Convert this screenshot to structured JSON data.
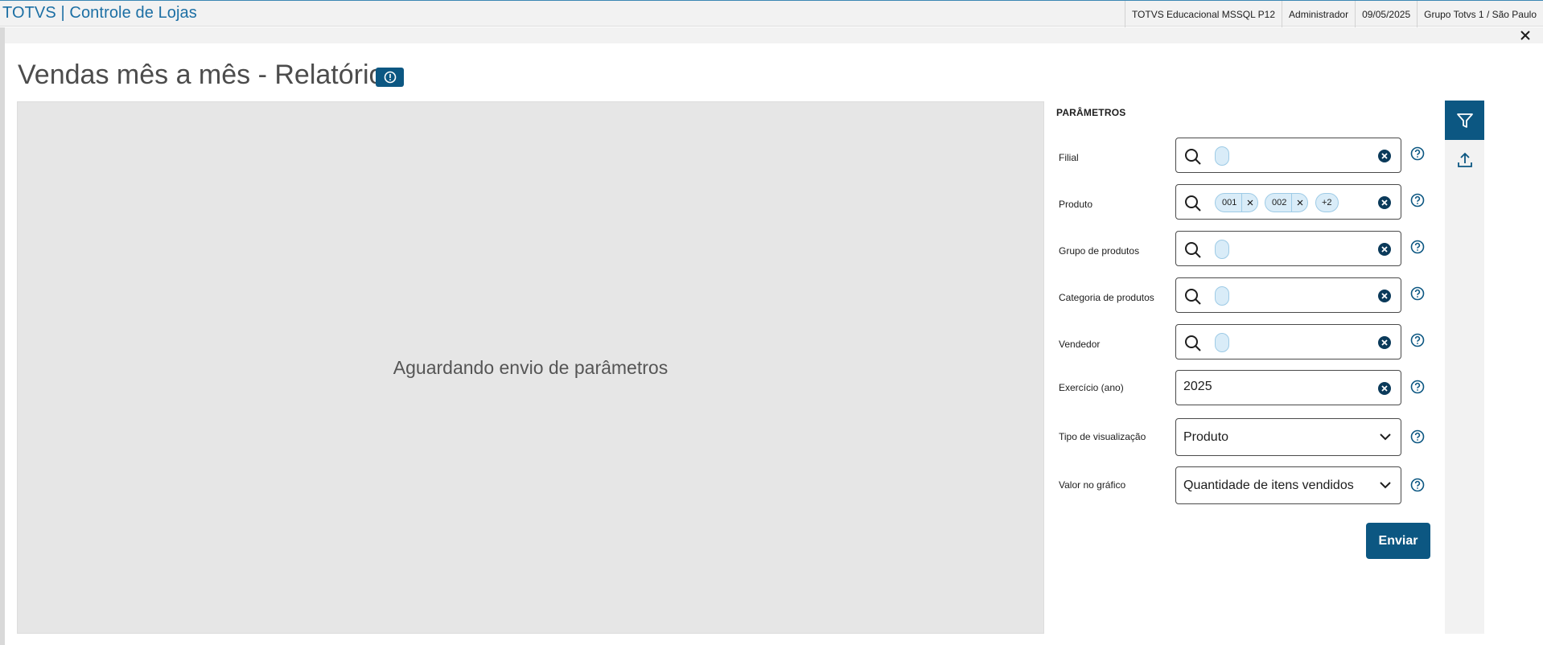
{
  "header": {
    "brand": "TOTVS | Controle de Lojas",
    "status": [
      "TOTVS Educacional MSSQL P12",
      "Administrador",
      "09/05/2025",
      "Grupo Totvs 1 / São Paulo"
    ]
  },
  "page": {
    "title": "Vendas mês a mês - Relatório"
  },
  "report": {
    "message": "Aguardando envio de parâmetros"
  },
  "params": {
    "title": "PARÂMETROS",
    "filial": {
      "label": "Filial"
    },
    "produto": {
      "label": "Produto",
      "chips": [
        "001",
        "002"
      ],
      "more": "+2"
    },
    "grupo": {
      "label": "Grupo de produtos"
    },
    "categoria": {
      "label": "Categoria de produtos"
    },
    "vendedor": {
      "label": "Vendedor"
    },
    "exercicio": {
      "label": "Exercício (ano)",
      "value": "2025"
    },
    "tipo": {
      "label": "Tipo de visualização",
      "value": "Produto"
    },
    "valor": {
      "label": "Valor no gráfico",
      "value": "Quantidade de itens vendidos"
    },
    "send_label": "Enviar"
  },
  "icons": {
    "brand_color": "#0c5782",
    "accent": "#1c6fa4"
  }
}
